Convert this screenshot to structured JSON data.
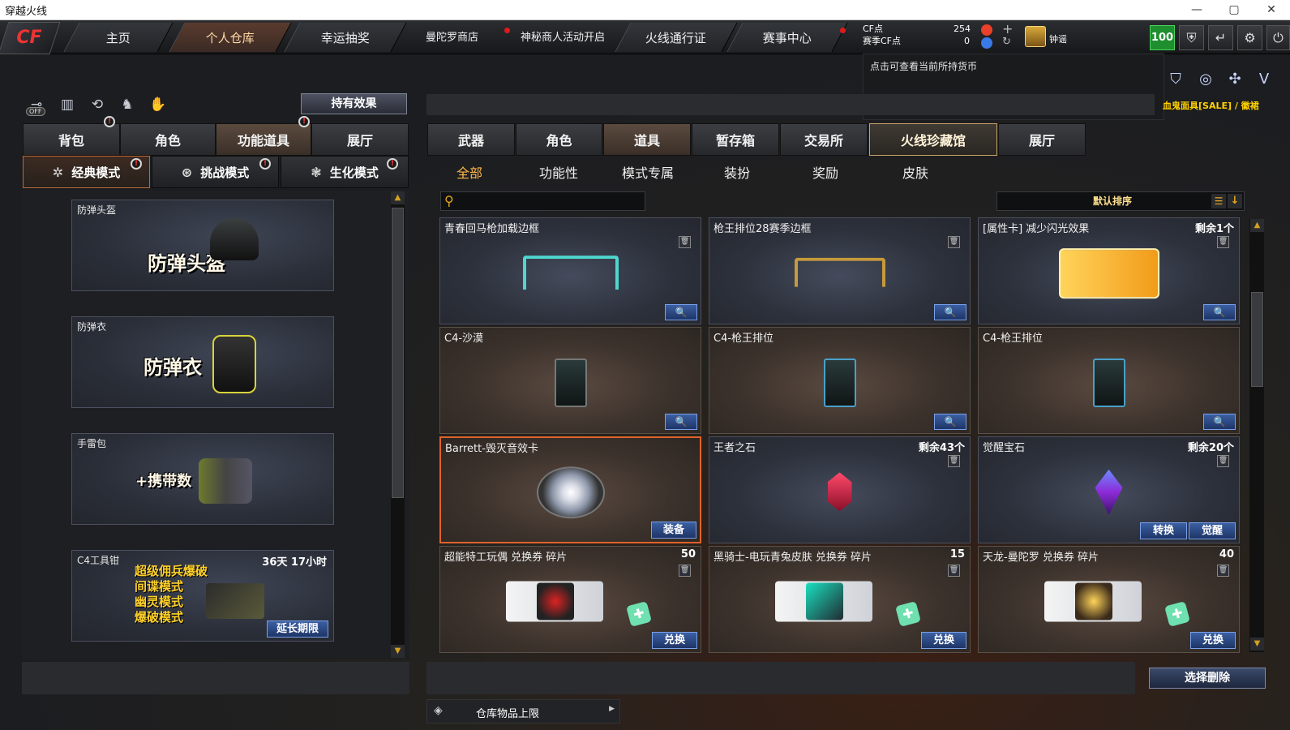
{
  "window": {
    "title": "穿越火线",
    "controls": [
      "—",
      "▢",
      "✕"
    ]
  },
  "topnav": {
    "logo": "CF",
    "tabs": [
      "主页",
      "个人仓库",
      "幸运抽奖"
    ],
    "active_tab": "个人仓库",
    "links": [
      "曼陀罗商店",
      "神秘商人活动开启"
    ],
    "tabs2": [
      "火线通行证",
      "赛事中心"
    ],
    "cf_label": "CF点",
    "cf_value": "254",
    "season_label": "赛季CF点",
    "season_value": "0",
    "username": "钟谣",
    "level": "100"
  },
  "tooltip": {
    "text": "点击可查看当前所持货币"
  },
  "promo": "血鬼面具[SALE] / 徽裙",
  "left": {
    "hold_effect_button": "持有效果",
    "off_badge": "OFF",
    "tabs": [
      "背包",
      "角色",
      "功能道具",
      "展厅"
    ],
    "active_tab": "功能道具",
    "modes": [
      "经典模式",
      "挑战模式",
      "生化模式"
    ],
    "items": [
      {
        "label": "防弹头盔",
        "big": "防弹头盔"
      },
      {
        "label": "防弹衣",
        "big": "防弹衣"
      },
      {
        "label": "手雷包",
        "big": "+携带数"
      },
      {
        "label": "C4工具钳",
        "time": "36天 17小时",
        "lines": [
          "超级佣兵爆破",
          "间谍模式",
          "幽灵模式",
          "爆破模式"
        ],
        "button": "延长期限"
      }
    ]
  },
  "right": {
    "tabs": [
      "武器",
      "角色",
      "道具",
      "暂存箱",
      "交易所",
      "火线珍藏馆",
      "展厅"
    ],
    "active_tab": "道具",
    "subtabs": [
      "全部",
      "功能性",
      "模式专属",
      "装扮",
      "奖励",
      "皮肤"
    ],
    "active_subtab": "全部",
    "search_placeholder": "",
    "sort_label": "默认排序",
    "items": [
      {
        "name": "青春回马枪加载边框",
        "remaining": "",
        "art": "frame-cyan",
        "bg": "blue",
        "actions": []
      },
      {
        "name": "枪王排位28赛季边框",
        "remaining": "",
        "art": "frame-gold",
        "bg": "blue",
        "actions": []
      },
      {
        "name": "[属性卡] 减少闪光效果",
        "remaining": "剩余1个",
        "art": "card",
        "bg": "blue",
        "actions": []
      },
      {
        "name": "C4-沙漠",
        "remaining": "",
        "art": "c4",
        "bg": "brown",
        "actions": []
      },
      {
        "name": "C4-枪王排位",
        "remaining": "",
        "art": "c4",
        "bg": "brown",
        "actions": []
      },
      {
        "name": "C4-枪王排位",
        "remaining": "",
        "art": "c4",
        "bg": "brown",
        "actions": []
      },
      {
        "name": "Barrett-毁灭音效卡",
        "remaining": "",
        "art": "disc",
        "bg": "selected",
        "actions": [
          "装备"
        ]
      },
      {
        "name": "王者之石",
        "remaining": "剩余43个",
        "art": "gem-red",
        "bg": "blue",
        "actions": []
      },
      {
        "name": "觉醒宝石",
        "remaining": "剩余20个",
        "art": "gem-purple",
        "bg": "blue",
        "actions": [
          "转换",
          "觉醒"
        ]
      },
      {
        "name": "超能特工玩偶 兑换券 碎片",
        "remaining": "50",
        "art": "ticket-red",
        "bg": "brown",
        "actions": [
          "兑换"
        ]
      },
      {
        "name": "黑骑士-电玩青兔皮肤 兑换券 碎片",
        "remaining": "15",
        "art": "ticket-cyan",
        "bg": "brown",
        "actions": [
          "兑换"
        ]
      },
      {
        "name": "天龙-曼陀罗 兑换券 碎片",
        "remaining": "40",
        "art": "ticket-gold",
        "bg": "brown",
        "actions": [
          "兑换"
        ]
      }
    ],
    "capacity_label": "仓库物品上限",
    "delete_button": "选择删除"
  },
  "colors": {
    "accent_orange": "#ffb84a",
    "button_blue": "#1e3567",
    "level_green": "#1f8e2f",
    "selected_border": "#e0632a"
  }
}
